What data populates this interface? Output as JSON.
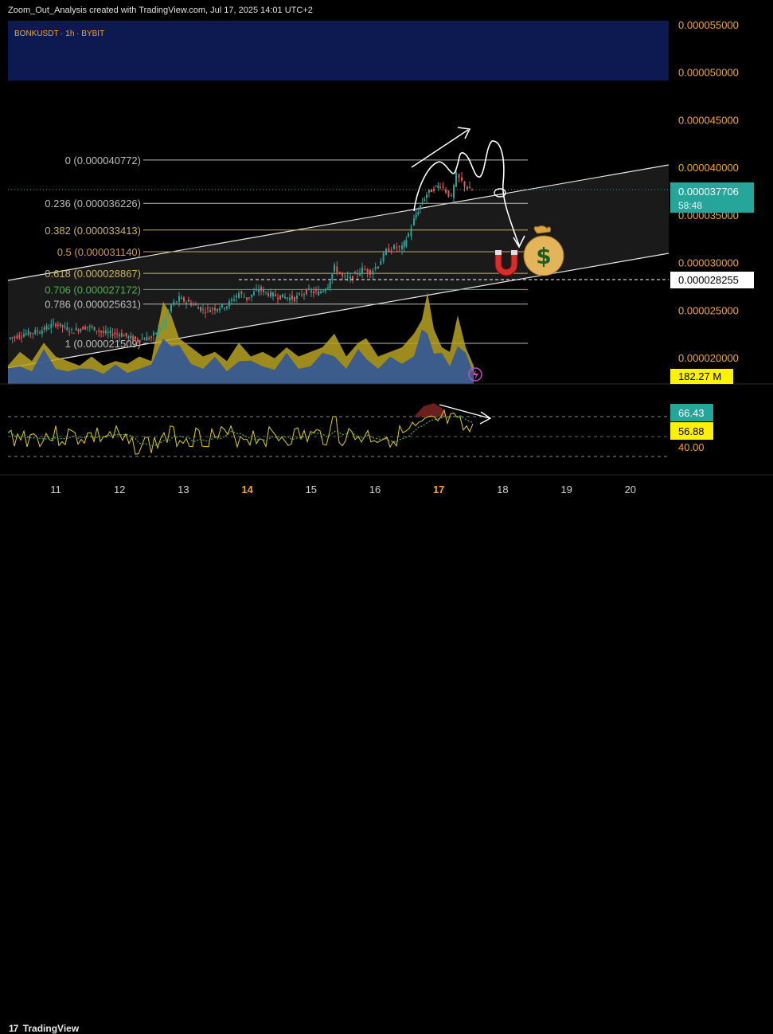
{
  "header": {
    "text": "Zoom_Out_Analysis created with TradingView.com, Jul 17, 2025 14:01 UTC+2"
  },
  "symbol": {
    "label": "BONKUSDT · 1h · BYBIT"
  },
  "footer": {
    "logo_text": "TradingView"
  },
  "colors": {
    "price_axis_text": "#f5a623",
    "up_candle": "#26a69a",
    "down_candle": "#ef5350",
    "fib_line": "#c9b458",
    "volume_yellow": "#b8a323",
    "volume_blue": "#2450a8",
    "rsi_line": "#e6d000",
    "rsi_ma": "#4caf50",
    "current_price_bg": "#26a69a",
    "top_band": "#0d1a52"
  },
  "chart_data": {
    "type": "candlestick",
    "symbol": "BONKUSDT",
    "timeframe": "1h",
    "exchange": "BYBIT",
    "price_axis": {
      "ticks": [
        "0.000055000",
        "0.000050000",
        "0.000045000",
        "0.000040000",
        "0.000035000",
        "0.000030000",
        "0.000025000",
        "0.000020000"
      ],
      "range": [
        1.65e-05,
        5.57e-05
      ]
    },
    "time_axis": {
      "ticks": [
        "11",
        "12",
        "13",
        "14",
        "15",
        "16",
        "17",
        "18",
        "19",
        "20"
      ],
      "highlighted": [
        "14",
        "17"
      ]
    },
    "current_price": {
      "value": "0.000037706",
      "countdown": "58:48"
    },
    "marked_price": "0.000028255",
    "volume_label": "182.27 M",
    "fib_levels": [
      {
        "label": "0 (0.000040772)",
        "value": 4.0772e-05,
        "color": "#bbbbbb"
      },
      {
        "label": "0.236 (0.000036226)",
        "value": 3.6226e-05,
        "color": "#bbbbbb"
      },
      {
        "label": "0.382 (0.000033413)",
        "value": 3.3413e-05,
        "color": "#c9b458"
      },
      {
        "label": "0.5 (0.000031140)",
        "value": 3.114e-05,
        "color": "#d89a3a"
      },
      {
        "label": "0.618 (0.000028867)",
        "value": 2.8867e-05,
        "color": "#c9b458"
      },
      {
        "label": "0.706 (0.000027172)",
        "value": 2.7172e-05,
        "color": "#4caf50"
      },
      {
        "label": "0.786 (0.000025631)",
        "value": 2.5631e-05,
        "color": "#bbbbbb"
      },
      {
        "label": "1 (0.000021509)",
        "value": 2.1509e-05,
        "color": "#bbbbbb"
      }
    ],
    "price_path": [
      [
        10,
        2.2e-05
      ],
      [
        30,
        2.25e-05
      ],
      [
        50,
        2.28e-05
      ],
      [
        70,
        2.36e-05
      ],
      [
        90,
        2.28e-05
      ],
      [
        110,
        2.33e-05
      ],
      [
        130,
        2.26e-05
      ],
      [
        150,
        2.25e-05
      ],
      [
        170,
        2.19e-05
      ],
      [
        190,
        2.21e-05
      ],
      [
        205,
        2.35e-05
      ],
      [
        215,
        2.55e-05
      ],
      [
        225,
        2.62e-05
      ],
      [
        240,
        2.57e-05
      ],
      [
        255,
        2.5e-05
      ],
      [
        270,
        2.52e-05
      ],
      [
        285,
        2.55e-05
      ],
      [
        300,
        2.68e-05
      ],
      [
        310,
        2.62e-05
      ],
      [
        325,
        2.72e-05
      ],
      [
        340,
        2.66e-05
      ],
      [
        355,
        2.64e-05
      ],
      [
        370,
        2.62e-05
      ],
      [
        385,
        2.7e-05
      ],
      [
        400,
        2.68e-05
      ],
      [
        412,
        2.76e-05
      ],
      [
        420,
        2.95e-05
      ],
      [
        430,
        2.85e-05
      ],
      [
        440,
        2.83e-05
      ],
      [
        455,
        2.93e-05
      ],
      [
        465,
        2.9e-05
      ],
      [
        475,
        2.98e-05
      ],
      [
        485,
        3.12e-05
      ],
      [
        495,
        3.16e-05
      ],
      [
        505,
        3.15e-05
      ],
      [
        513,
        3.3e-05
      ],
      [
        520,
        3.45e-05
      ],
      [
        528,
        3.6e-05
      ],
      [
        536,
        3.72e-05
      ],
      [
        545,
        3.78e-05
      ],
      [
        553,
        3.82e-05
      ],
      [
        560,
        3.75e-05
      ],
      [
        567,
        3.68e-05
      ],
      [
        573,
        3.92e-05
      ],
      [
        580,
        3.85e-05
      ],
      [
        587,
        3.78e-05
      ],
      [
        593,
        3.76e-05
      ]
    ],
    "volume_profile": [
      [
        10,
        0.2
      ],
      [
        25,
        0.35
      ],
      [
        40,
        0.25
      ],
      [
        55,
        0.45
      ],
      [
        70,
        0.3
      ],
      [
        85,
        0.25
      ],
      [
        100,
        0.2
      ],
      [
        115,
        0.3
      ],
      [
        130,
        0.2
      ],
      [
        145,
        0.25
      ],
      [
        160,
        0.22
      ],
      [
        175,
        0.3
      ],
      [
        190,
        0.25
      ],
      [
        205,
        0.9
      ],
      [
        215,
        0.75
      ],
      [
        225,
        0.5
      ],
      [
        240,
        0.4
      ],
      [
        255,
        0.3
      ],
      [
        270,
        0.35
      ],
      [
        285,
        0.25
      ],
      [
        300,
        0.45
      ],
      [
        315,
        0.3
      ],
      [
        330,
        0.35
      ],
      [
        345,
        0.28
      ],
      [
        360,
        0.4
      ],
      [
        375,
        0.3
      ],
      [
        390,
        0.35
      ],
      [
        405,
        0.4
      ],
      [
        420,
        0.55
      ],
      [
        435,
        0.3
      ],
      [
        450,
        0.45
      ],
      [
        460,
        0.5
      ],
      [
        475,
        0.3
      ],
      [
        490,
        0.35
      ],
      [
        505,
        0.4
      ],
      [
        520,
        0.55
      ],
      [
        530,
        0.7
      ],
      [
        537,
        1.0
      ],
      [
        545,
        0.6
      ],
      [
        555,
        0.4
      ],
      [
        565,
        0.35
      ],
      [
        575,
        0.75
      ],
      [
        585,
        0.4
      ],
      [
        595,
        0.2
      ]
    ],
    "rsi": {
      "value": "66.43",
      "ma_value": "56.88",
      "level_40": "40.00"
    }
  }
}
